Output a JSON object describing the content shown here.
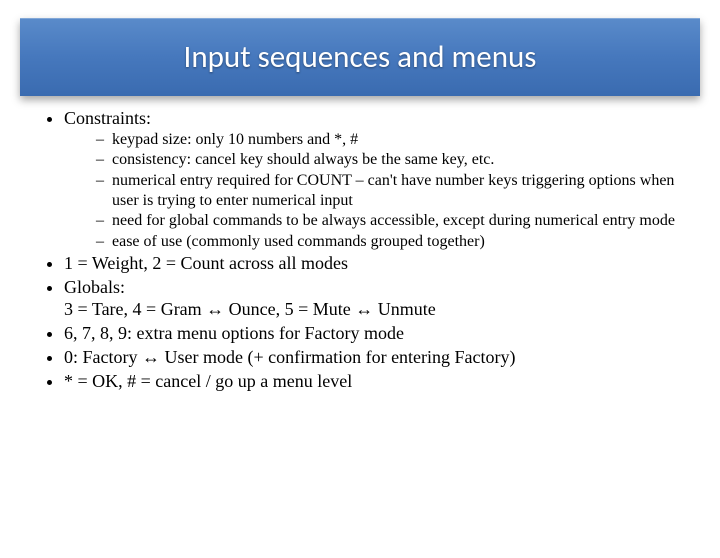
{
  "title": "Input sequences and menus",
  "bullets": {
    "constraints_label": "Constraints:",
    "constraints": {
      "c1": "keypad size: only 10 numbers and *, #",
      "c2": "consistency: cancel key should always be the same key, etc.",
      "c3": "numerical entry required for COUNT – can't have number keys triggering options when user is trying to enter numerical input",
      "c4": "need for global commands to be always accessible, except during numerical entry mode",
      "c5": "ease of use (commonly used commands grouped together)"
    },
    "b2": "1 = Weight, 2 = Count across all modes",
    "b3": "Globals:\n3 = Tare, 4 = Gram ↔ Ounce, 5 = Mute ↔ Unmute",
    "b4": "6, 7, 8, 9: extra menu options for Factory mode",
    "b5": "0: Factory ↔ User mode (+ confirmation for entering Factory)",
    "b6": "* = OK, # = cancel / go up a menu level"
  }
}
